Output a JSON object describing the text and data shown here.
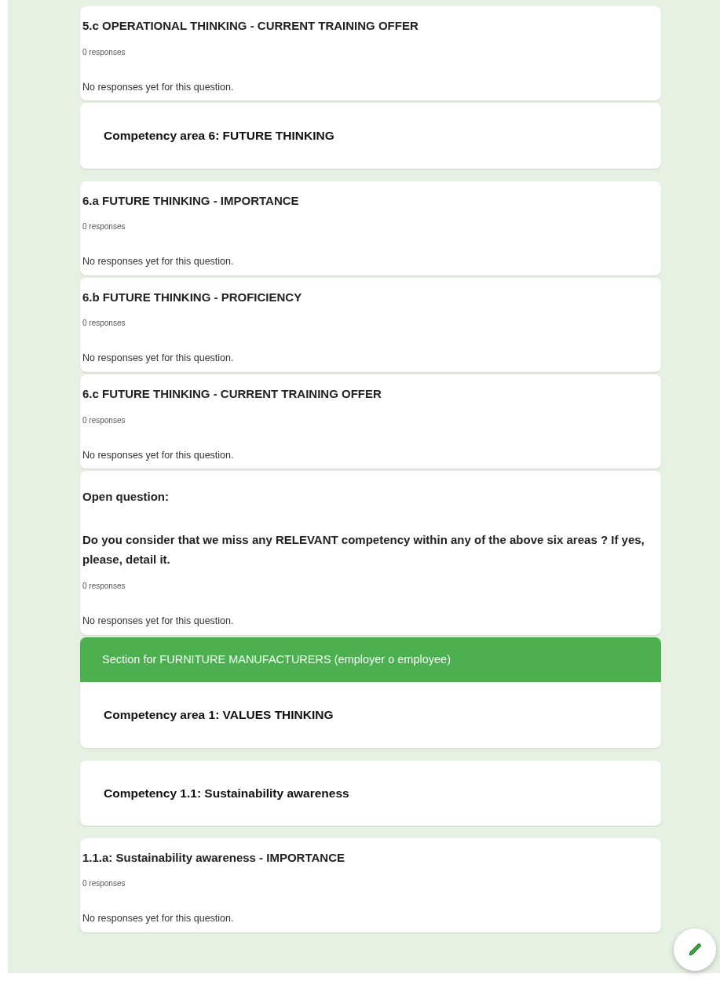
{
  "items": [
    {
      "kind": "question",
      "title": "5.c OPERATIONAL THINKING -  CURRENT TRAINING OFFER",
      "responses": "0 responses",
      "empty": "No responses yet for this question."
    },
    {
      "kind": "heading",
      "title": "Competency area 6: FUTURE THINKING"
    },
    {
      "kind": "question",
      "title": "6.a FUTURE THINKING - IMPORTANCE",
      "responses": "0 responses",
      "empty": "No responses yet for this question."
    },
    {
      "kind": "question",
      "title": "6.b FUTURE THINKING - PROFICIENCY",
      "responses": "0 responses",
      "empty": "No responses yet for this question."
    },
    {
      "kind": "question",
      "title": "6.c FUTURE THINKING -  CURRENT TRAINING OFFER",
      "responses": "0 responses",
      "empty": "No responses yet for this question."
    },
    {
      "kind": "open",
      "title": "Open question:",
      "question": "Do you consider that we miss any RELEVANT competency within any of the above six areas ? If yes, please, detail it.",
      "responses": "0 responses",
      "empty": "No responses yet for this question."
    },
    {
      "kind": "section",
      "header": "Section for FURNITURE MANUFACTURERS (employer o employee)",
      "title": "Competency area 1: VALUES THINKING"
    },
    {
      "kind": "heading",
      "title": "Competency 1.1: Sustainability awareness"
    },
    {
      "kind": "question",
      "title": "1.1.a: Sustainability awareness - IMPORTANCE",
      "responses": "0 responses",
      "empty": "No responses yet for this question."
    }
  ]
}
